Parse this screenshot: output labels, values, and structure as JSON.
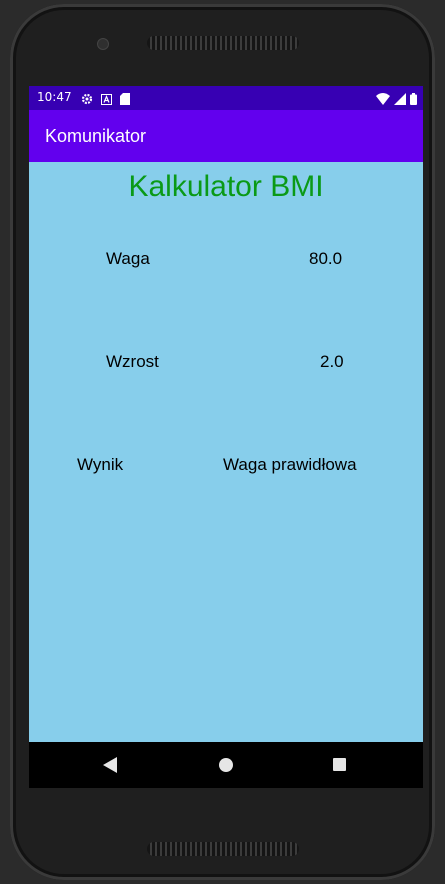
{
  "status_bar": {
    "time": "10:47",
    "left_icons": [
      "gear-icon",
      "a-badge-icon",
      "sd-card-icon"
    ],
    "right_icons": [
      "wifi-icon",
      "signal-icon",
      "battery-icon"
    ]
  },
  "app_bar": {
    "title": "Komunikator"
  },
  "main": {
    "heading": "Kalkulator BMI",
    "weight": {
      "label": "Waga",
      "value": "80.0"
    },
    "height": {
      "label": "Wzrost",
      "value": "2.0"
    },
    "result": {
      "label": "Wynik",
      "value": "Waga prawidłowa"
    }
  },
  "nav_bar": {
    "buttons": [
      "back-icon",
      "home-icon",
      "recent-apps-icon"
    ]
  },
  "colors": {
    "status_bar": "#3700b3",
    "app_bar": "#6200ee",
    "background": "#87ceeb",
    "heading": "#0a9a17"
  }
}
